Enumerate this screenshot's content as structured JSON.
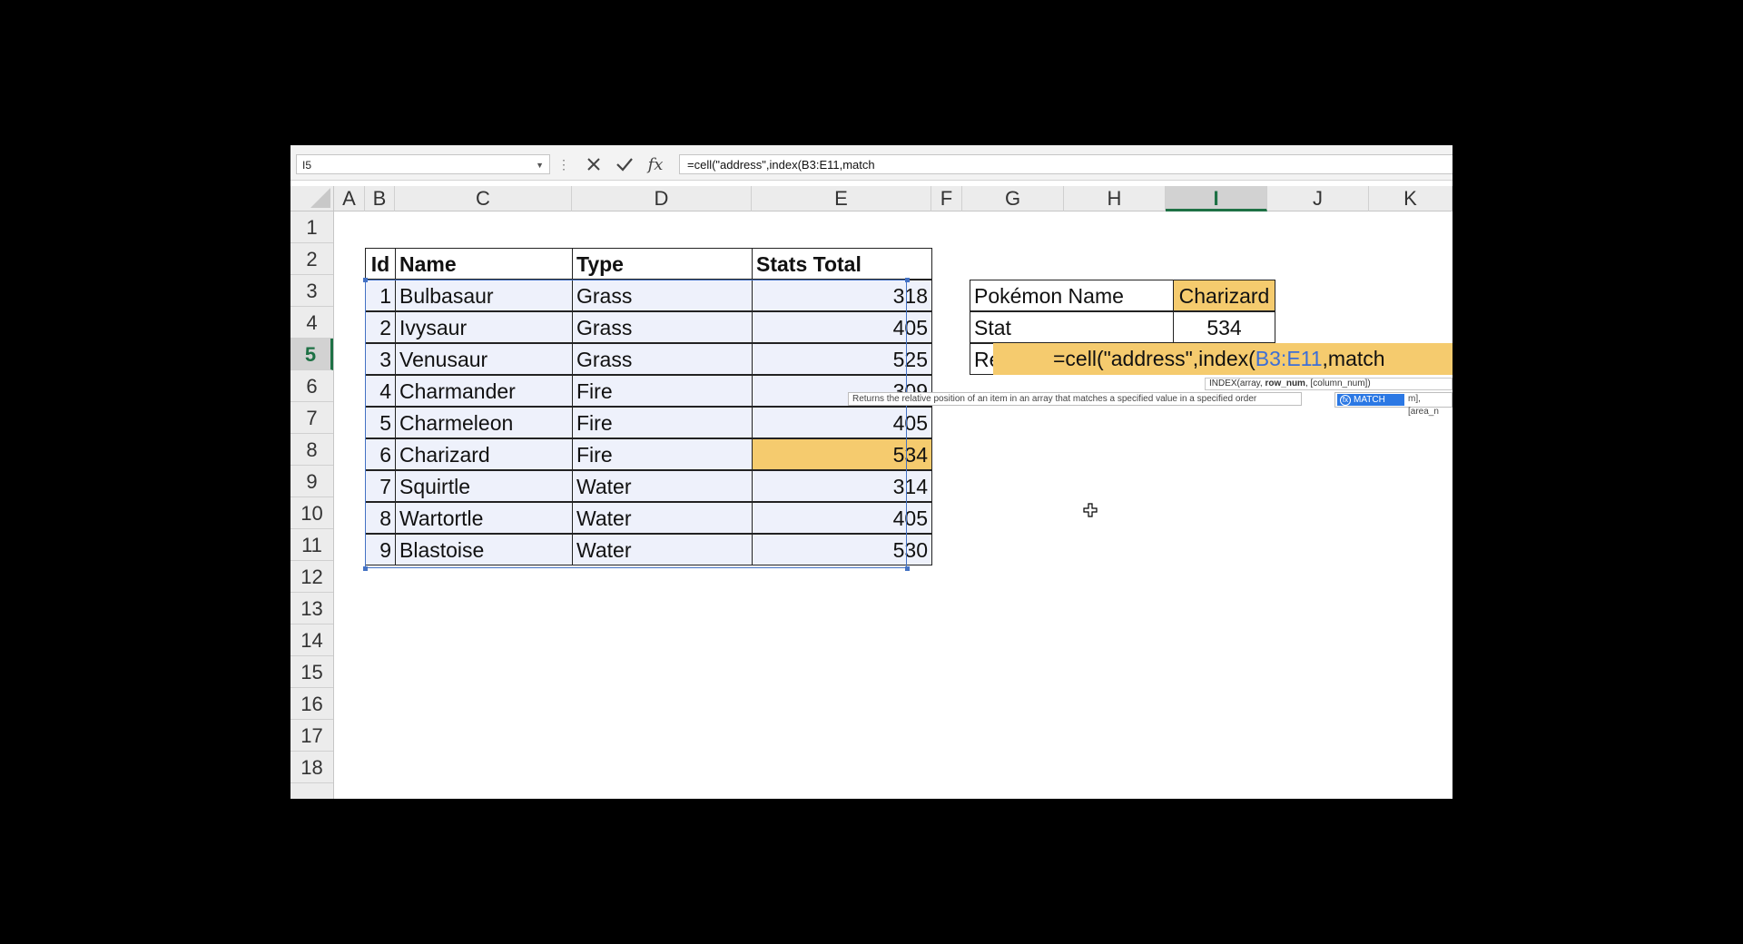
{
  "formula_bar": {
    "name_box": "I5",
    "dots": "⋮",
    "formula": "=cell(\"address\",index(B3:E11,match"
  },
  "columns": [
    "A",
    "B",
    "C",
    "D",
    "E",
    "F",
    "G",
    "H",
    "I",
    "J",
    "K"
  ],
  "rows": [
    "1",
    "2",
    "3",
    "4",
    "5",
    "6",
    "7",
    "8",
    "9",
    "10",
    "11",
    "12",
    "13",
    "14",
    "15",
    "16",
    "17",
    "18"
  ],
  "active_column": "I",
  "active_row": "5",
  "table": {
    "headers": [
      "Id",
      "Name",
      "Type",
      "Stats Total"
    ],
    "rows": [
      [
        "1",
        "Bulbasaur",
        "Grass",
        "318"
      ],
      [
        "2",
        "Ivysaur",
        "Grass",
        "405"
      ],
      [
        "3",
        "Venusaur",
        "Grass",
        "525"
      ],
      [
        "4",
        "Charmander",
        "Fire",
        "309"
      ],
      [
        "5",
        "Charmeleon",
        "Fire",
        "405"
      ],
      [
        "6",
        "Charizard",
        "Fire",
        "534"
      ],
      [
        "7",
        "Squirtle",
        "Water",
        "314"
      ],
      [
        "8",
        "Wartortle",
        "Water",
        "405"
      ],
      [
        "9",
        "Blastoise",
        "Water",
        "530"
      ]
    ]
  },
  "lookup": {
    "name_label": "Pokémon Name",
    "name_value": "Charizard",
    "stat_label": "Stat",
    "stat_value": "534",
    "result_label": "Re"
  },
  "editing": {
    "prefix": "=cell(\"address\",index(",
    "range": "B3:E11",
    "suffix": ",match"
  },
  "tooltips": {
    "index_signature_prefix": "INDEX(array, ",
    "index_signature_bold": "row_num",
    "index_signature_suffix": ", [column_num])",
    "match_description": "Returns the relative position of an item in an array that matches a specified value in a specified order",
    "autocomplete_item": "MATCH",
    "autocomplete_tail": "m], [area_n"
  },
  "colors": {
    "highlight": "#f5cb6e",
    "selection": "#4472c4",
    "active_header": "#1e7145",
    "table_fill": "#eef1fb"
  }
}
